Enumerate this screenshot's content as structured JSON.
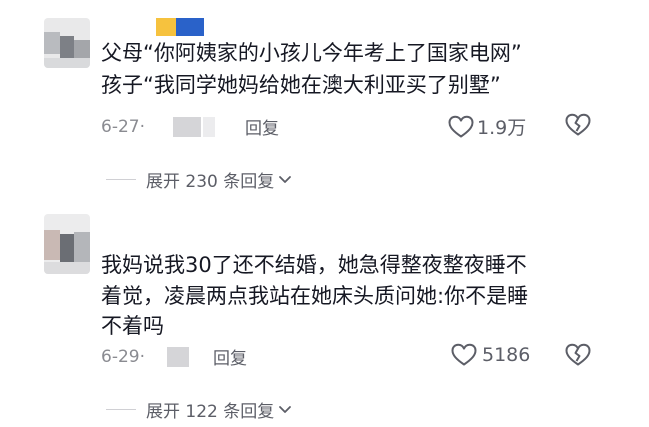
{
  "comments": [
    {
      "text_lines": [
        "父母“你阿姨家的小孩儿今年考上了国家电网”",
        "孩子“我同学她妈给她在澳大利亚买了别墅”"
      ],
      "date": "6-27·",
      "reply_label": "回复",
      "likes": "1.9万",
      "expand_label": "展开 230 条回复"
    },
    {
      "text_lines": [
        "我妈说我30了还不结婚，她急得整夜整夜睡不",
        "着觉，凌晨两点我站在她床头质问她:你不是睡",
        "不着吗"
      ],
      "date": "6-29·",
      "reply_label": "回复",
      "likes": "5186",
      "expand_label": "展开 122 条回复"
    }
  ],
  "icons": {
    "like": "heart-outline-icon",
    "dislike": "broken-heart-icon",
    "expand": "chevron-down-icon"
  },
  "colors": {
    "text": "#161823",
    "secondary": "#5c5e67",
    "muted": "#8a8b91",
    "censor_yellow": "#f6c23e",
    "censor_blue": "#2a62c9"
  }
}
